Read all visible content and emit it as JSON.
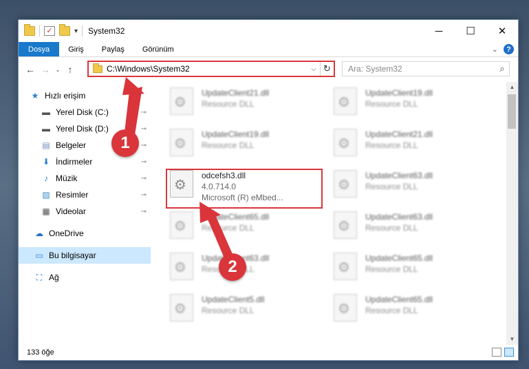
{
  "window": {
    "title": "System32",
    "controls": {
      "minimize": "─",
      "maximize": "☐",
      "close": "✕"
    }
  },
  "ribbon": {
    "tabs": [
      "Dosya",
      "Giriş",
      "Paylaş",
      "Görünüm"
    ],
    "help": "?"
  },
  "nav": {
    "back": "←",
    "forward": "→",
    "recent": "⌄",
    "up": "↑",
    "address": "C:\\Windows\\System32",
    "address_dropdown": "⌵",
    "refresh": "↻",
    "search_placeholder": "Ara: System32",
    "search_icon": "⌕"
  },
  "sidebar": {
    "items": [
      {
        "label": "Hızlı erişim",
        "icon": "star-icon",
        "glyph": "★",
        "pinned": false
      },
      {
        "label": "Yerel Disk (C:)",
        "icon": "drive-icon",
        "glyph": "▬",
        "pinned": true
      },
      {
        "label": "Yerel Disk (D:)",
        "icon": "drive-icon",
        "glyph": "▬",
        "pinned": true
      },
      {
        "label": "Belgeler",
        "icon": "documents-icon",
        "glyph": "▤",
        "pinned": true
      },
      {
        "label": "İndirmeler",
        "icon": "download-icon",
        "glyph": "⬇",
        "pinned": true
      },
      {
        "label": "Müzik",
        "icon": "music-icon",
        "glyph": "♪",
        "pinned": true
      },
      {
        "label": "Resimler",
        "icon": "pictures-icon",
        "glyph": "▨",
        "pinned": true
      },
      {
        "label": "Videolar",
        "icon": "video-icon",
        "glyph": "▦",
        "pinned": true
      }
    ],
    "onedrive": {
      "label": "OneDrive",
      "glyph": "☁"
    },
    "thispc": {
      "label": "Bu bilgisayar",
      "glyph": "▭"
    },
    "network": {
      "label": "Ağ",
      "glyph": "⛶"
    },
    "pin_glyph": "📌"
  },
  "files": [
    {
      "name": "UpdateClient21.dll",
      "desc": "Resource DLL",
      "col": 0,
      "row": 0,
      "blurred": true
    },
    {
      "name": "UpdateClient19.dll",
      "desc": "Resource DLL",
      "col": 1,
      "row": 0,
      "blurred": true
    },
    {
      "name": "UpdateClient19.dll",
      "desc": "Resource DLL",
      "col": 0,
      "row": 1,
      "blurred": true
    },
    {
      "name": "UpdateClient21.dll",
      "desc": "Resource DLL",
      "col": 1,
      "row": 1,
      "blurred": true
    },
    {
      "name": "odcefsh3.dll",
      "desc": "4.0.714.0",
      "desc2": "Microsoft (R) eMbed...",
      "col": 0,
      "row": 2,
      "blurred": false
    },
    {
      "name": "UpdateClient63.dll",
      "desc": "Resource DLL",
      "col": 1,
      "row": 2,
      "blurred": true
    },
    {
      "name": "UpdateClient65.dll",
      "desc": "Resource DLL",
      "col": 0,
      "row": 3,
      "blurred": true
    },
    {
      "name": "UpdateClient63.dll",
      "desc": "Resource DLL",
      "col": 1,
      "row": 3,
      "blurred": true
    },
    {
      "name": "UpdateClient63.dll",
      "desc": "Resource DLL",
      "col": 0,
      "row": 4,
      "blurred": true
    },
    {
      "name": "UpdateClient65.dll",
      "desc": "Resource DLL",
      "col": 1,
      "row": 4,
      "blurred": true
    },
    {
      "name": "UpdateClient5.dll",
      "desc": "Resource DLL",
      "col": 0,
      "row": 5,
      "blurred": true
    },
    {
      "name": "UpdateClient65.dll",
      "desc": "Resource DLL",
      "col": 1,
      "row": 5,
      "blurred": true
    }
  ],
  "status": {
    "count": "133 öğe"
  },
  "annotations": {
    "step1": "1",
    "step2": "2",
    "color": "#d9353a"
  },
  "colors": {
    "accent": "#1979ca",
    "selection": "#cce8ff",
    "highlight": "#d9353a"
  }
}
